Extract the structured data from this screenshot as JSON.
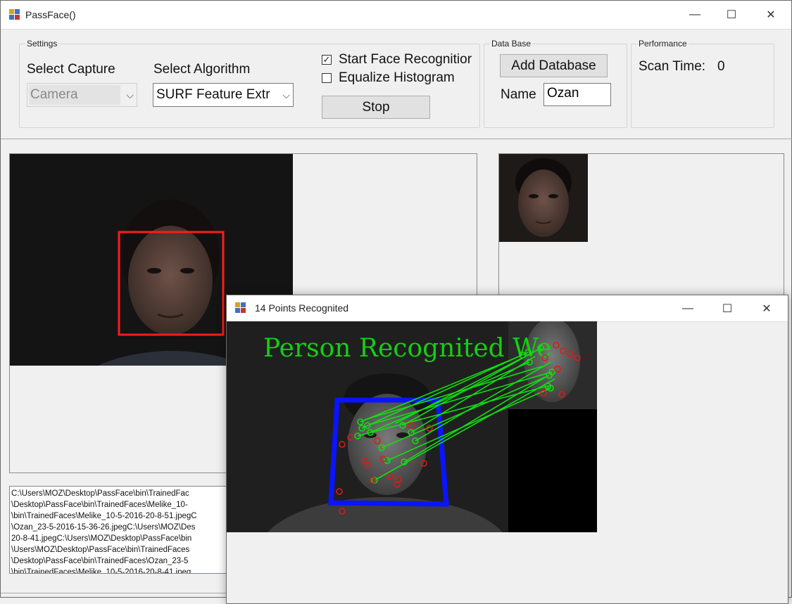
{
  "main_window": {
    "title": "PassFace()",
    "controls": {
      "minimize": "—",
      "maximize": "☐",
      "close": "✕"
    }
  },
  "settings": {
    "group_label": "Settings",
    "capture_label": "Select Capture",
    "capture_value": "Camera",
    "algorithm_label": "Select Algorithm",
    "algorithm_value": "SURF Feature Extr",
    "start_face_recognition": {
      "label": "Start Face Recognitior",
      "checked": true
    },
    "equalize_histogram": {
      "label": "Equalize Histogram",
      "checked": false
    },
    "stop_button": "Stop"
  },
  "database": {
    "group_label": "Data Base",
    "add_button": "Add Database",
    "name_label": "Name",
    "name_value": "Ozan"
  },
  "performance": {
    "group_label": "Performance",
    "scan_time_label": "Scan Time:",
    "scan_time_value": "0"
  },
  "log_lines": [
    "C:\\Users\\MOZ\\Desktop\\PassFace\\bin\\TrainedFac",
    "\\Desktop\\PassFace\\bin\\TrainedFaces\\Melike_10-",
    "\\bin\\TrainedFaces\\Melike_10-5-2016-20-8-51.jpegC",
    "\\Ozan_23-5-2016-15-36-26.jpegC:\\Users\\MOZ\\Des",
    "20-8-41.jpegC:\\Users\\MOZ\\Desktop\\PassFace\\bin",
    "\\Users\\MOZ\\Desktop\\PassFace\\bin\\TrainedFaces",
    "\\Desktop\\PassFace\\bin\\TrainedFaces\\Ozan_23-5",
    "\\bin\\TrainedFaces\\Melike_10-5-2016-20-8-41.jpeg"
  ],
  "match_window": {
    "title": "14 Points Recognited",
    "overlay_text": "Person Recognited We",
    "controls": {
      "minimize": "—",
      "maximize": "☐",
      "close": "✕"
    }
  },
  "colors": {
    "face_box_main": "#ff1a1a",
    "face_box_match": "#0a14ff",
    "match_lines": "#10e010",
    "keypoints_unmatched": "#e01818"
  }
}
